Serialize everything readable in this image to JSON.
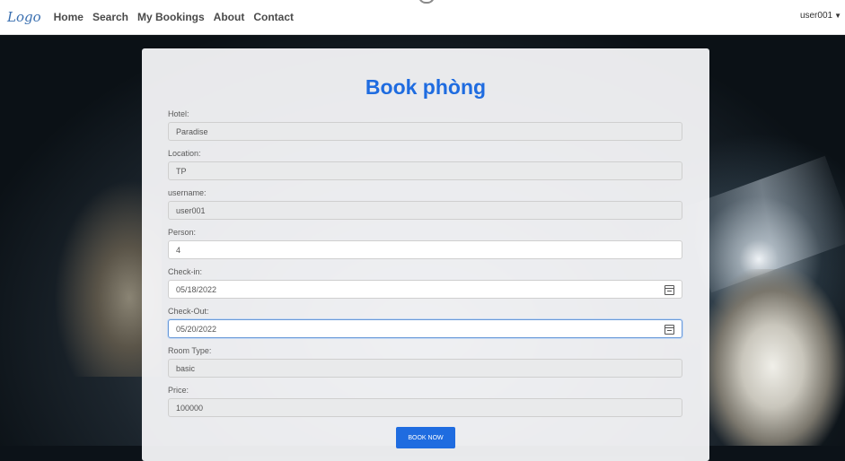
{
  "nav": {
    "logo": "Logo",
    "links": [
      "Home",
      "Search",
      "My Bookings",
      "About",
      "Contact"
    ],
    "user": "user001"
  },
  "form": {
    "title": "Book phòng",
    "fields": [
      {
        "label": "Hotel:",
        "value": "Paradise"
      },
      {
        "label": "Location:",
        "value": "TP"
      },
      {
        "label": "username:",
        "value": "user001"
      },
      {
        "label": "Person:",
        "value": "4"
      },
      {
        "label": "Check-in:",
        "value": "05/18/2022"
      },
      {
        "label": "Check-Out:",
        "value": "05/20/2022"
      },
      {
        "label": "Room Type:",
        "value": "basic"
      },
      {
        "label": "Price:",
        "value": "100000"
      }
    ],
    "submit_label": "BOOK NOW"
  },
  "colors": {
    "accent": "#1f6ce0"
  },
  "icons": {
    "date_picker": "calendar-icon",
    "user_menu": "chevron-down-icon"
  }
}
